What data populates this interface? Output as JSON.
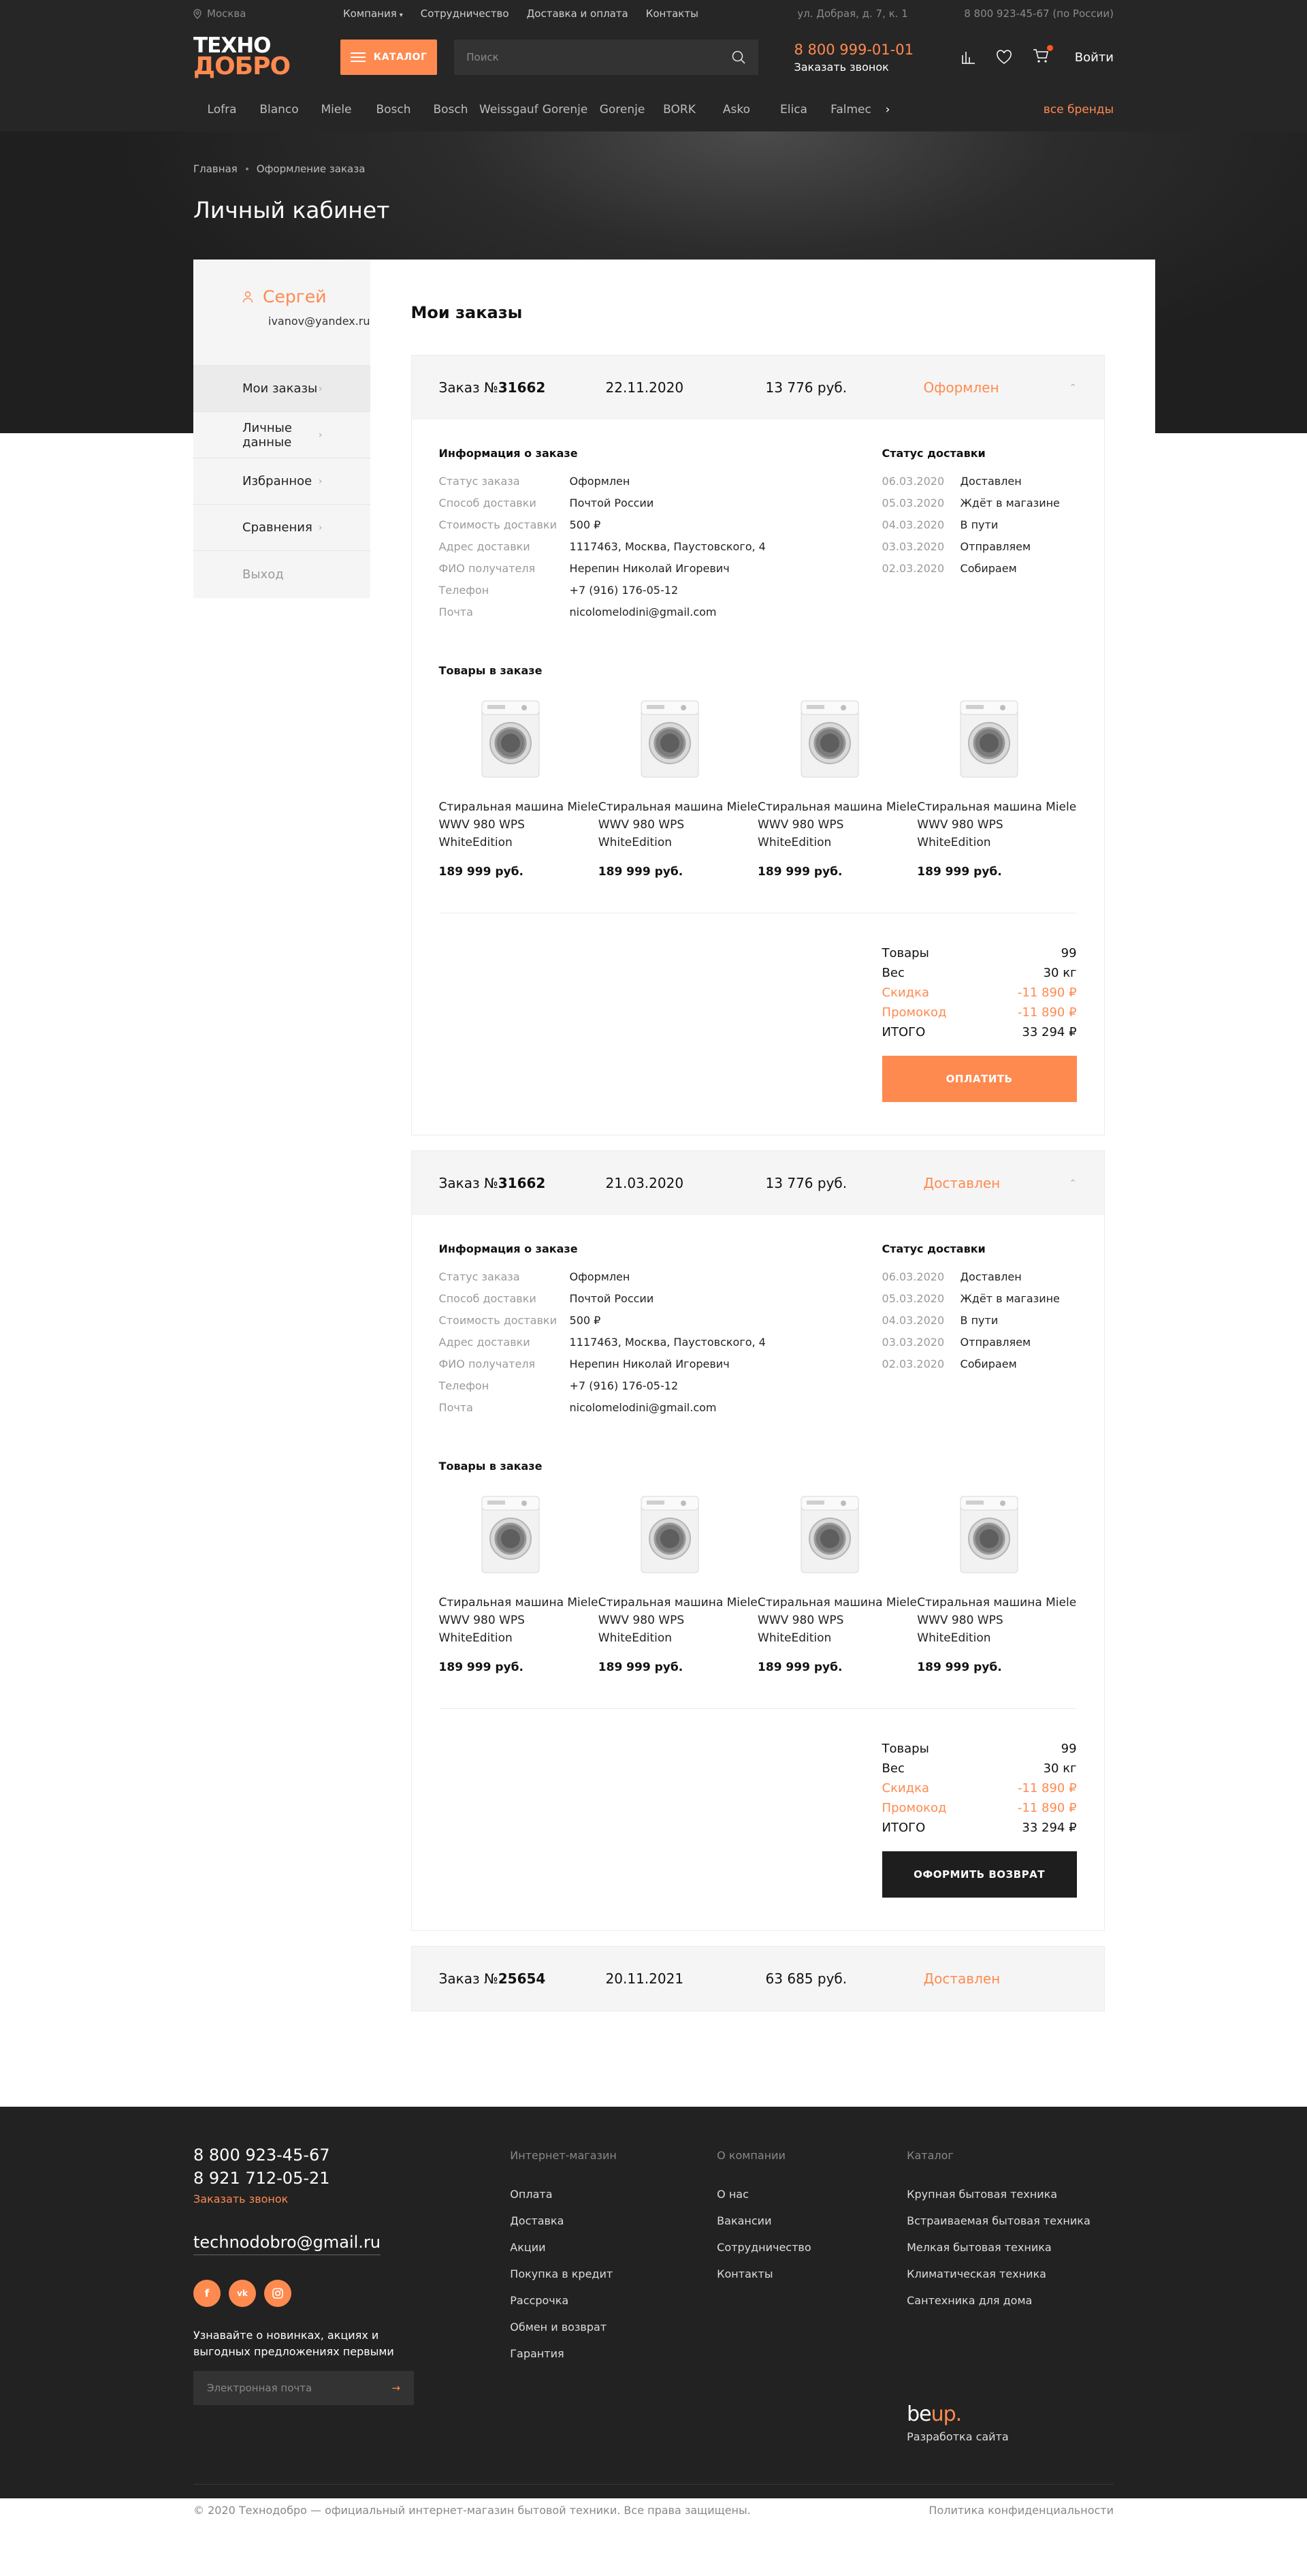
{
  "header": {
    "city": "Москва",
    "nav": [
      "Компания",
      "Сотрудничество",
      "Доставка и оплата",
      "Контакты"
    ],
    "address": "ул. Добрая, д. 7, к. 1",
    "phone_ru": "8 800 923-45-67 (по России)",
    "logo_top": "ТЕХНО",
    "logo_bottom": "ДОБРО",
    "catalog_label": "КАТАЛОГ",
    "search_placeholder": "Поиск",
    "phone": "8 800 999-01-01",
    "callback": "Заказать звонок",
    "login": "Войти",
    "brands": [
      "Lofra",
      "Blanco",
      "Miele",
      "Bosch",
      "Bosch",
      "Weissgauf",
      "Gorenje",
      "Gorenje",
      "BORK",
      "Asko",
      "Elica",
      "Falmec"
    ],
    "all_brands": "все бренды",
    "colors": {
      "accent": "#ff8a50",
      "dark": "#262626"
    }
  },
  "hero": {
    "breadcrumbs": [
      "Главная",
      "Оформление заказа"
    ],
    "title": "Личный кабинет"
  },
  "sidebar": {
    "user_name": "Сергей",
    "user_email": "ivanov@yandex.ru",
    "items": [
      "Мои заказы",
      "Личные данные",
      "Избранное",
      "Сравнения"
    ],
    "logout": "Выход"
  },
  "main": {
    "title": "Мои заказы",
    "labels": {
      "info": "Информация о заказе",
      "delivery": "Статус доставки",
      "goods": "Товары в заказе",
      "status": "Статус заказа",
      "method": "Способ доставки",
      "cost": "Стоимость доставки",
      "address": "Адрес доставки",
      "recipient": "ФИО получателя",
      "phone": "Телефон",
      "email": "Почта",
      "t_goods": "Товары",
      "t_weight": "Вес",
      "t_discount": "Скидка",
      "t_promo": "Промокод",
      "t_total": "ИТОГО"
    },
    "orders": [
      {
        "num_prefix": "Заказ №",
        "num": "31662",
        "date": "22.11.2020",
        "sum": "13 776 руб.",
        "status_label": "Оформлен",
        "info": {
          "status": "Оформлен",
          "method": "Почтой России",
          "cost": "500 ₽",
          "address": "1117463, Москва, Паустовского, 4",
          "recipient": "Нерепин Николай Игоревич",
          "phone": "+7 (916) 176-05-12",
          "email": "nicolomelodini@gmail.com"
        },
        "delivery": [
          {
            "date": "06.03.2020",
            "text": "Доставлен"
          },
          {
            "date": "05.03.2020",
            "text": "Ждёт в магазине"
          },
          {
            "date": "04.03.2020",
            "text": "В пути"
          },
          {
            "date": "03.03.2020",
            "text": "Отправляем"
          },
          {
            "date": "02.03.2020",
            "text": "Собираем"
          }
        ],
        "goods": [
          {
            "name": "Стиральная машина Miele WWV 980 WPS WhiteEdition",
            "price": "189 999 руб."
          },
          {
            "name": "Стиральная машина Miele WWV 980 WPS WhiteEdition",
            "price": "189 999 руб."
          },
          {
            "name": "Стиральная машина Miele WWV 980 WPS WhiteEdition",
            "price": "189 999 руб."
          },
          {
            "name": "Стиральная машина Miele WWV 980 WPS WhiteEdition",
            "price": "189 999 руб."
          }
        ],
        "totals": {
          "goods": "99",
          "weight": "30 кг",
          "discount": "-11 890 ₽",
          "promo": "-11 890 ₽",
          "total": "33 294  ₽"
        },
        "button": "ОПЛАТИТЬ"
      },
      {
        "num_prefix": "Заказ №",
        "num": "31662",
        "date": "21.03.2020",
        "sum": "13 776 руб.",
        "status_label": "Доставлен",
        "info": {
          "status": "Оформлен",
          "method": "Почтой России",
          "cost": "500 ₽",
          "address": "1117463, Москва, Паустовского, 4",
          "recipient": "Нерепин Николай Игоревич",
          "phone": "+7 (916) 176-05-12",
          "email": "nicolomelodini@gmail.com"
        },
        "delivery": [
          {
            "date": "06.03.2020",
            "text": "Доставлен"
          },
          {
            "date": "05.03.2020",
            "text": "Ждёт в магазине"
          },
          {
            "date": "04.03.2020",
            "text": "В пути"
          },
          {
            "date": "03.03.2020",
            "text": "Отправляем"
          },
          {
            "date": "02.03.2020",
            "text": "Собираем"
          }
        ],
        "goods": [
          {
            "name": "Стиральная машина Miele WWV 980 WPS WhiteEdition",
            "price": "189 999 руб."
          },
          {
            "name": "Стиральная машина Miele WWV 980 WPS WhiteEdition",
            "price": "189 999 руб."
          },
          {
            "name": "Стиральная машина Miele WWV 980 WPS WhiteEdition",
            "price": "189 999 руб."
          },
          {
            "name": "Стиральная машина Miele WWV 980 WPS WhiteEdition",
            "price": "189 999 руб."
          }
        ],
        "totals": {
          "goods": "99",
          "weight": "30 кг",
          "discount": "-11 890 ₽",
          "promo": "-11 890 ₽",
          "total": "33 294  ₽"
        },
        "button": "ОФОРМИТЬ ВОЗВРАТ"
      },
      {
        "num_prefix": "Заказ №",
        "num": "25654",
        "date": "20.11.2021",
        "sum": "63 685 руб.",
        "status_label": "Доставлен"
      }
    ]
  },
  "footer": {
    "phone1": "8 800 923-45-67",
    "phone2": "8 921 712-05-21",
    "callback": "Заказать звонок",
    "email": "technodobro@gmail.ru",
    "socials": [
      "f",
      "vk",
      "ig"
    ],
    "subscribe_text": "Узнавайте о новинках, акциях и выгодных предложениях первыми",
    "email_placeholder": "Электронная почта",
    "col1": {
      "title": "Интернет-магазин",
      "links": [
        "Оплата",
        "Доставка",
        "Акции",
        "Покупка в кредит",
        "Рассрочка",
        "Обмен и возврат",
        "Гарантия"
      ]
    },
    "col2": {
      "title": "О компании",
      "links": [
        "О нас",
        "Вакансии",
        "Сотрудничество",
        "Контакты"
      ]
    },
    "col3": {
      "title": "Каталог",
      "links": [
        "Крупная бытовая техника",
        "Встраиваемая бытовая техника",
        "Мелкая бытовая техника",
        "Климатическая техника",
        "Сантехника для дома"
      ]
    },
    "dev_logo_a": "be",
    "dev_logo_b": "up.",
    "dev_text": "Разработка сайта",
    "copyright": "© 2020 Технодобро — официальный интернет-магазин бытовой техники. Все права защищены.",
    "privacy": "Политика конфиденциальности"
  }
}
